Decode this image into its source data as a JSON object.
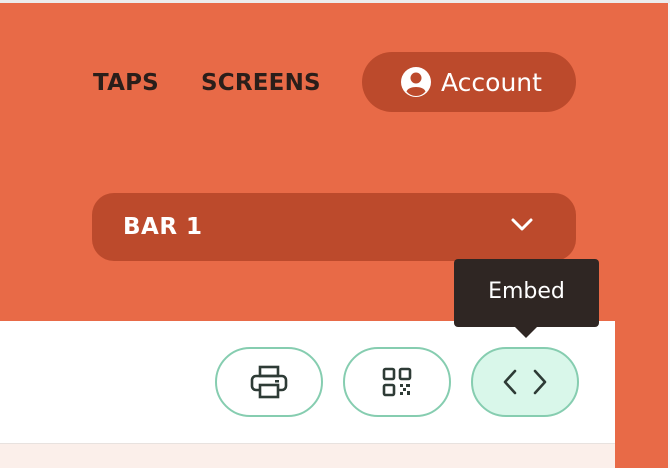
{
  "nav": {
    "taps_label": "TAPS",
    "screens_label": "SCREENS",
    "account_label": "Account",
    "account_icon": "user-circle-icon"
  },
  "selector": {
    "selected_value": "BAR 1",
    "icon": "chevron-down-icon"
  },
  "toolbar": {
    "buttons": [
      {
        "name": "print",
        "icon": "printer-icon"
      },
      {
        "name": "qr-code",
        "icon": "qr-code-icon"
      },
      {
        "name": "embed",
        "icon": "code-brackets-icon"
      }
    ],
    "tooltip_text": "Embed"
  },
  "colors": {
    "header_background": "#e86a47",
    "pill_background": "#bc4a2c",
    "button_border": "#86cdb0",
    "active_button_background": "#d9f7ea",
    "tooltip_background": "#2f2623"
  }
}
